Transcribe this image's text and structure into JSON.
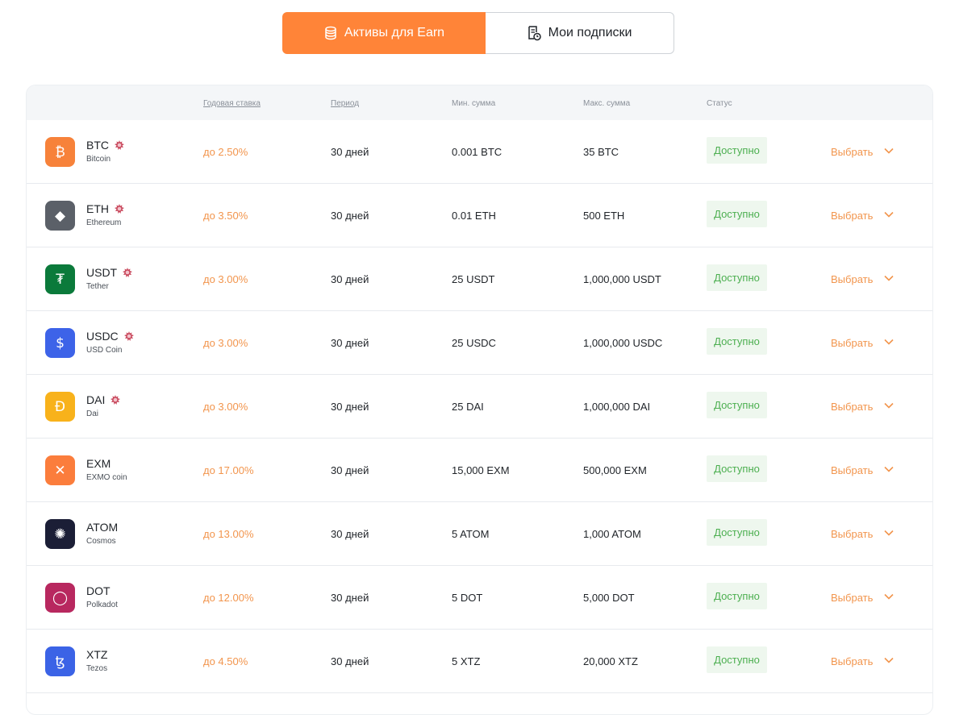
{
  "tabs": {
    "active_label": "Активы для Earn",
    "inactive_label": "Мои подписки"
  },
  "table": {
    "headers": {
      "rate": "Годовая ставка",
      "period": "Период",
      "min": "Мин. сумма",
      "max": "Макс. сумма",
      "status": "Статус"
    },
    "rows": [
      {
        "symbol": "BTC",
        "name": "Bitcoin",
        "rate": "до 2.50%",
        "period": "30 дней",
        "min": "0.001 BTC",
        "max": "35 BTC",
        "status": "Доступно",
        "action": "Выбрать",
        "color": "#f7823a",
        "glyph": "₿",
        "fire": true
      },
      {
        "symbol": "ETH",
        "name": "Ethereum",
        "rate": "до 3.50%",
        "period": "30 дней",
        "min": "0.01 ETH",
        "max": "500 ETH",
        "status": "Доступно",
        "action": "Выбрать",
        "color": "#5b6068",
        "glyph": "◆",
        "fire": true
      },
      {
        "symbol": "USDT",
        "name": "Tether",
        "rate": "до 3.00%",
        "period": "30 дней",
        "min": "25 USDT",
        "max": "1,000,000 USDT",
        "status": "Доступно",
        "action": "Выбрать",
        "color": "#0b7a3b",
        "glyph": "₮",
        "fire": true
      },
      {
        "symbol": "USDC",
        "name": "USD Coin",
        "rate": "до 3.00%",
        "period": "30 дней",
        "min": "25 USDC",
        "max": "1,000,000 USDC",
        "status": "Доступно",
        "action": "Выбрать",
        "color": "#3d63e8",
        "glyph": "$",
        "fire": true
      },
      {
        "symbol": "DAI",
        "name": "Dai",
        "rate": "до 3.00%",
        "period": "30 дней",
        "min": "25 DAI",
        "max": "1,000,000 DAI",
        "status": "Доступно",
        "action": "Выбрать",
        "color": "#f8b21b",
        "glyph": "Đ",
        "fire": true
      },
      {
        "symbol": "EXM",
        "name": "EXMO coin",
        "rate": "до 17.00%",
        "period": "30 дней",
        "min": "15,000 EXM",
        "max": "500,000 EXM",
        "status": "Доступно",
        "action": "Выбрать",
        "color": "#fb7d3c",
        "glyph": "✕",
        "fire": false
      },
      {
        "symbol": "ATOM",
        "name": "Cosmos",
        "rate": "до 13.00%",
        "period": "30 дней",
        "min": "5 ATOM",
        "max": "1,000 ATOM",
        "status": "Доступно",
        "action": "Выбрать",
        "color": "#1b1e36",
        "glyph": "✺",
        "fire": false
      },
      {
        "symbol": "DOT",
        "name": "Polkadot",
        "rate": "до 12.00%",
        "period": "30 дней",
        "min": "5 DOT",
        "max": "5,000 DOT",
        "status": "Доступно",
        "action": "Выбрать",
        "color": "#b8285f",
        "glyph": "◯",
        "fire": false
      },
      {
        "symbol": "XTZ",
        "name": "Tezos",
        "rate": "до 4.50%",
        "period": "30 дней",
        "min": "5 XTZ",
        "max": "20,000 XTZ",
        "status": "Доступно",
        "action": "Выбрать",
        "color": "#3b63e6",
        "glyph": "ꜩ",
        "fire": false
      }
    ]
  }
}
